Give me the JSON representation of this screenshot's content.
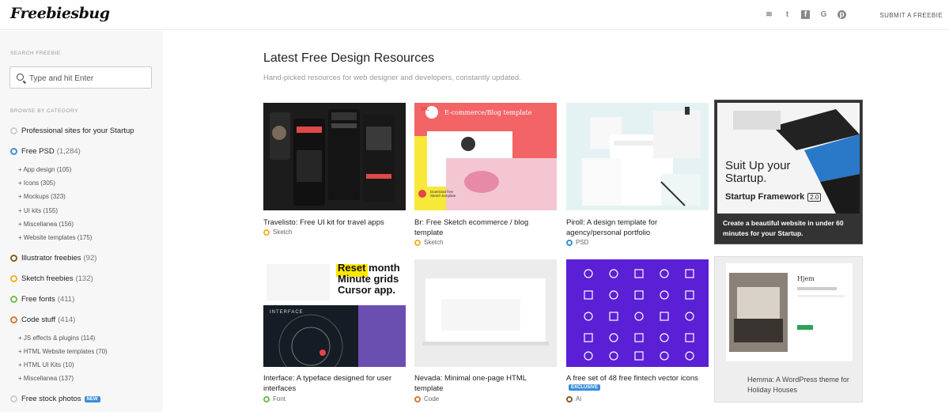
{
  "header": {
    "logo": "Freebiesbug",
    "icons": [
      "rss-icon",
      "twitter-icon",
      "facebook-icon",
      "google-icon",
      "pinterest-icon"
    ],
    "icon_glyphs": [
      "≋",
      "t",
      "f",
      "G",
      "p"
    ],
    "submit_label": "SUBMIT A FREEBIE"
  },
  "sidebar": {
    "search_heading": "SEARCH FREEBIE",
    "search_placeholder": "Type and hit Enter",
    "browse_heading": "BROWSE BY CATEGORY",
    "categories": [
      {
        "label": "Professional sites for your Startup",
        "count": "",
        "color": "#cccccc"
      },
      {
        "label": "Free PSD",
        "count": "(1,284)",
        "color": "#3b8fd9"
      },
      {
        "label": "Illustrator freebies",
        "count": "(92)",
        "color": "#8a5a2b"
      },
      {
        "label": "Sketch freebies",
        "count": "(132)",
        "color": "#f0b429"
      },
      {
        "label": "Free fonts",
        "count": "(411)",
        "color": "#6dbf4b"
      },
      {
        "label": "Code stuff",
        "count": "(414)",
        "color": "#d9773b"
      },
      {
        "label": "Free stock photos",
        "count": "",
        "color": "#cccccc",
        "badge": "NEW"
      }
    ],
    "psd_subs": [
      "+ App design (105)",
      "+ Icons (305)",
      "+ Mockups (323)",
      "+ UI kits (155)",
      "+ Miscellanea (156)",
      "+ Website templates (175)"
    ],
    "code_subs": [
      "+ JS effects & plugins (114)",
      "+ HTML Website templates (70)",
      "+ HTML UI Kits (10)",
      "+ Miscellanea (137)"
    ]
  },
  "main": {
    "title": "Latest Free Design Resources",
    "subtitle": "Hand-picked resources for web designer and developers, constantly updated."
  },
  "cards": [
    {
      "title": "Travelisto: Free UI kit for travel apps",
      "tag": "Sketch",
      "tag_color": "#f0b429"
    },
    {
      "title": "Br: Free Sketch ecommerce / blog template",
      "tag": "Sketch",
      "tag_color": "#f0b429"
    },
    {
      "title": "Piroll: A design template for agency/personal portfolio",
      "tag": "PSD",
      "tag_color": "#3b8fd9"
    },
    {
      "title": "Interface: A typeface designed for user interfaces",
      "tag": "Font",
      "tag_color": "#6dbf4b"
    },
    {
      "title": "Nevada: Minimal one-page HTML template",
      "tag": "Code",
      "tag_color": "#d9773b"
    },
    {
      "title": "A free set of 48 free fintech vector icons",
      "tag": "Ai",
      "tag_color": "#8a5a2b",
      "badge": "EXCLUSIVE"
    },
    {
      "title": "Hemma: A WordPress theme for Holiday Houses"
    }
  ],
  "promo": {
    "headline": "Suit Up your Startup.",
    "product": "Startup Framework",
    "version": "2.0",
    "text": "Create a beautiful website in under 60 minutes for your Startup."
  },
  "thumbs": {
    "br_heading": "E-commerce/Blog template",
    "br_logo": "BR.",
    "br_button": "Download free Sketch template",
    "interface_big": [
      "Reset month",
      "Minute grids",
      "Cursor app."
    ],
    "interface_label": "INTERFACE",
    "hemma_brand": "Hjem"
  }
}
